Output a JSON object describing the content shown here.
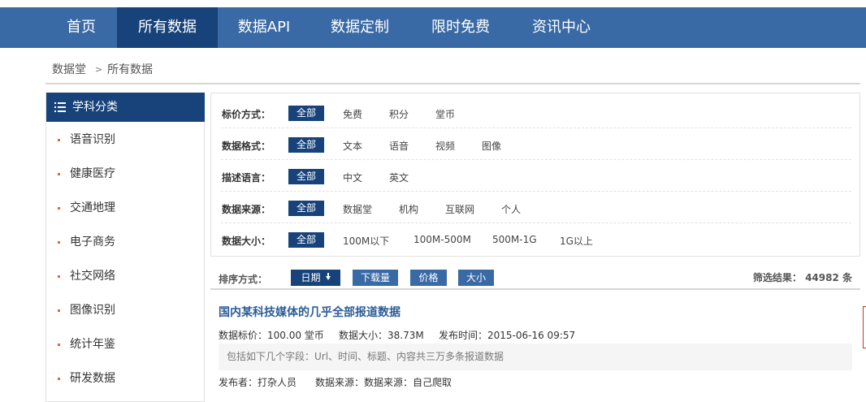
{
  "nav": {
    "items": [
      {
        "label": "首页"
      },
      {
        "label": "所有数据"
      },
      {
        "label": "数据API"
      },
      {
        "label": "数据定制"
      },
      {
        "label": "限时免费"
      },
      {
        "label": "资讯中心"
      }
    ],
    "active_index": 1
  },
  "breadcrumb": {
    "home": "数据堂",
    "separator": ">",
    "current": "所有数据"
  },
  "sidebar": {
    "title": "学科分类",
    "title_icon": "list-icon",
    "items": [
      {
        "label": "语音识别"
      },
      {
        "label": "健康医疗"
      },
      {
        "label": "交通地理"
      },
      {
        "label": "电子商务"
      },
      {
        "label": "社交网络"
      },
      {
        "label": "图像识别"
      },
      {
        "label": "统计年鉴"
      },
      {
        "label": "研发数据"
      }
    ]
  },
  "filters": [
    {
      "label": "标价方式：",
      "options": [
        "全部",
        "免费",
        "积分",
        "堂币"
      ]
    },
    {
      "label": "数据格式：",
      "options": [
        "全部",
        "文本",
        "语音",
        "视频",
        "图像"
      ]
    },
    {
      "label": "描述语言：",
      "options": [
        "全部",
        "中文",
        "英文"
      ]
    },
    {
      "label": "数据来源：",
      "options": [
        "全部",
        "数据堂",
        "机构",
        "互联网",
        "个人"
      ]
    },
    {
      "label": "数据大小：",
      "options": [
        "全部",
        "100M以下",
        "100M-500M",
        "500M-1G",
        "1G以上"
      ]
    }
  ],
  "sort": {
    "label": "排序方式：",
    "buttons": [
      "日期",
      "下载量",
      "价格",
      "大小"
    ],
    "active_index": 0,
    "result_text": "筛选结果： 44982 条"
  },
  "dataset": {
    "title": "国内某科技媒体的几乎全部报道数据",
    "price": "数据标价：100.00 堂币",
    "size": "数据大小：38.73M",
    "published": "发布时间：2015-06-16 09:57",
    "description": "包括如下几个字段：Url、时间、标题、内容共三万多条报道数据",
    "publisher": "发布者：打杂人员",
    "source": "数据来源：数据来源：自己爬取"
  },
  "colors": {
    "nav_bg": "#3a6aa5",
    "accent_dark": "#17437a",
    "link": "#2c5c97",
    "bullet": "#e06a2a"
  }
}
